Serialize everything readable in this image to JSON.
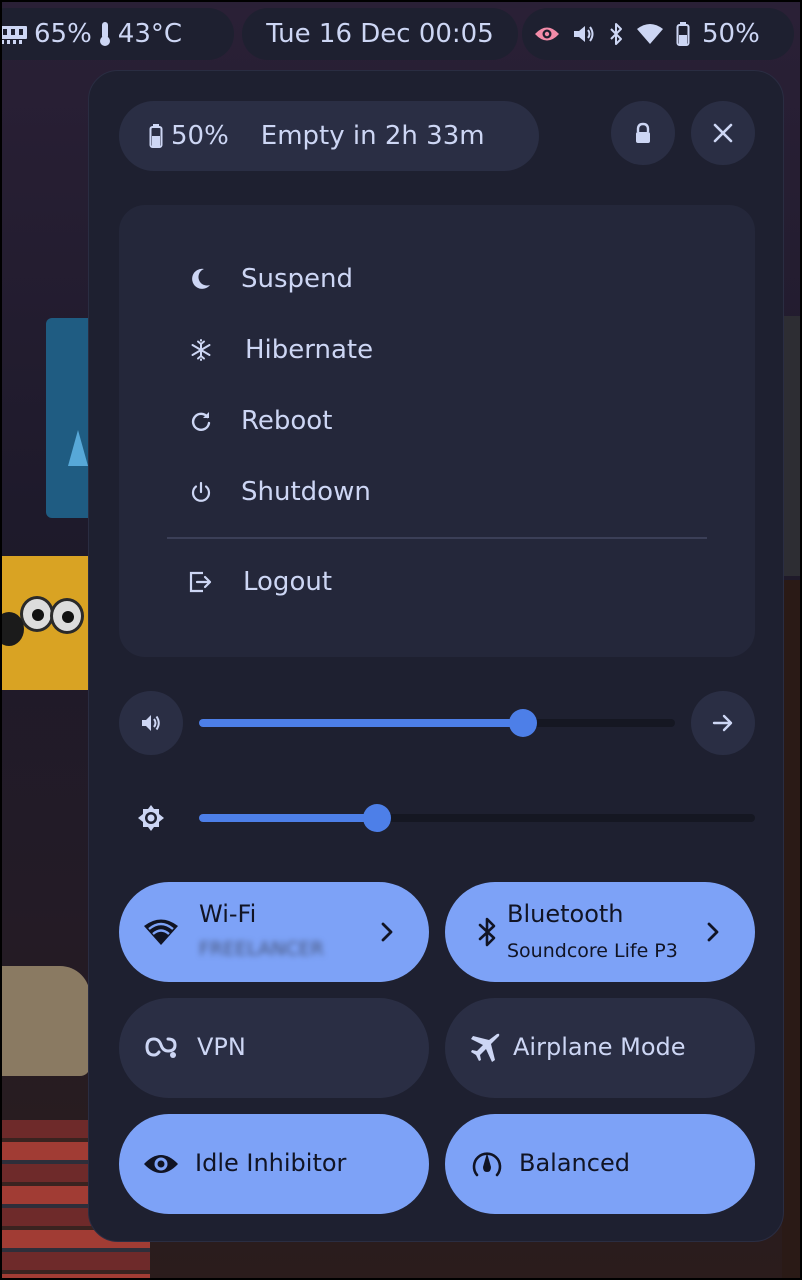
{
  "colors": {
    "panel_bg": "#1e2030",
    "card_bg": "#24273a",
    "button_bg": "#2a2e44",
    "accent": "#7da2f7",
    "slider_fill": "#4d7fe8",
    "text": "#cdd6f4",
    "privacy_indicator": "#f38ba8"
  },
  "topbar": {
    "ram_usage": "65%",
    "temperature": "43°C",
    "clock": "Tue 16 Dec 00:05",
    "battery": "50%",
    "icons": [
      "memory-icon",
      "thermometer-icon",
      "privacy-eye-icon",
      "volume-icon",
      "bluetooth-icon",
      "wifi-icon",
      "battery-icon"
    ]
  },
  "panel": {
    "battery": {
      "percent": "50%",
      "estimate": "Empty in 2h 33m"
    },
    "buttons": [
      "lock-icon",
      "close-icon"
    ],
    "power_menu": {
      "items": [
        {
          "label": "Suspend",
          "icon": "moon-icon"
        },
        {
          "label": "Hibernate",
          "icon": "snowflake-icon"
        },
        {
          "label": "Reboot",
          "icon": "restart-icon"
        },
        {
          "label": "Shutdown",
          "icon": "power-icon"
        },
        {
          "label": "Logout",
          "icon": "logout-icon"
        }
      ]
    },
    "volume": {
      "level_percent": 68,
      "icon": "volume-icon",
      "action_icon": "arrow-right-icon"
    },
    "brightness": {
      "level_percent": 32,
      "icon": "brightness-icon"
    },
    "toggles": {
      "wifi": {
        "label": "Wi-Fi",
        "subtitle": "FREELANCER",
        "active": true,
        "icon": "wifi-icon"
      },
      "bluetooth": {
        "label": "Bluetooth",
        "subtitle": "Soundcore Life P3",
        "active": true,
        "icon": "bluetooth-icon"
      },
      "vpn": {
        "label": "VPN",
        "active": false,
        "icon": "vpn-icon"
      },
      "airplane": {
        "label": "Airplane Mode",
        "active": false,
        "icon": "airplane-icon"
      },
      "idle_inhibitor": {
        "label": "Idle Inhibitor",
        "active": true,
        "icon": "eye-icon"
      },
      "power_profile": {
        "label": "Balanced",
        "active": true,
        "icon": "power-profile-icon"
      }
    }
  }
}
